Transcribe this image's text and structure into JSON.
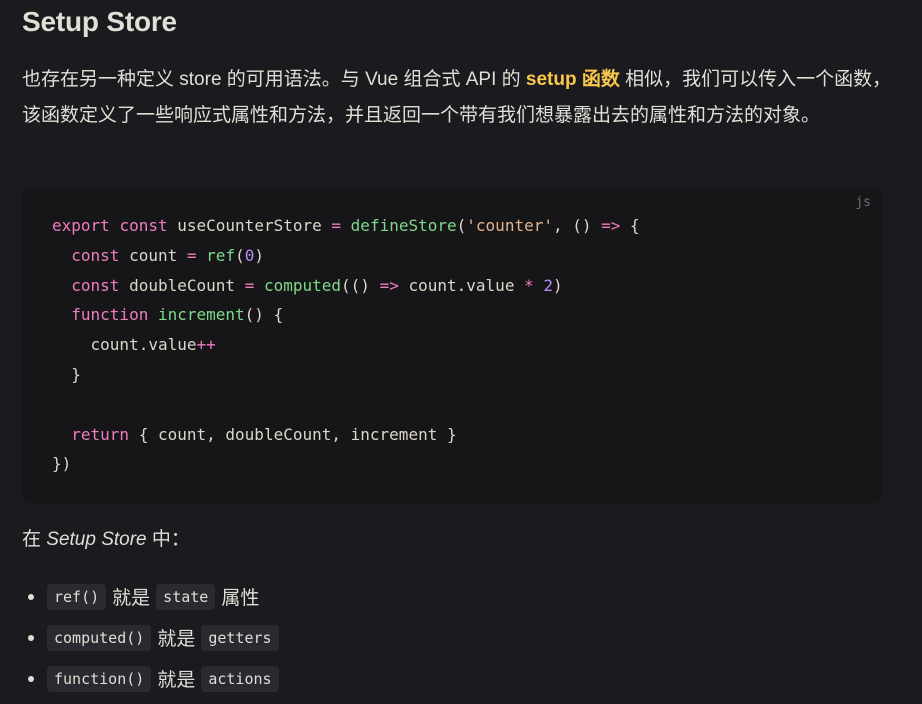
{
  "heading": "Setup Store",
  "intro": {
    "part1": "也存在另一种定义 store 的可用语法。与 Vue 组合式 API 的 ",
    "link": "setup 函数",
    "part2": " 相似，我们可以传入一个函数，该函数定义了一些响应式属性和方法，并且返回一个带有我们想暴露出去的属性和方法的对象。"
  },
  "code": {
    "lang": "js",
    "lines": [
      "export const useCounterStore = defineStore('counter', () => {",
      "  const count = ref(0)",
      "  const doubleCount = computed(() => count.value * 2)",
      "  function increment() {",
      "    count.value++",
      "  }",
      "",
      "  return { count, doubleCount, increment }",
      "})"
    ]
  },
  "subheading": {
    "prefix": "在 ",
    "em": "Setup Store",
    "suffix": " 中："
  },
  "list": [
    {
      "code": "ref()",
      "word": "就是",
      "target": "state",
      "suffix": "属性"
    },
    {
      "code": "computed()",
      "word": "就是",
      "target": "getters",
      "suffix": ""
    },
    {
      "code": "function()",
      "word": "就是",
      "target": "actions",
      "suffix": ""
    }
  ],
  "colors": {
    "background": "#1b1b1f",
    "code_background": "#161618",
    "link": "#f9c84a",
    "keyword": "#f07cc0",
    "function": "#7fd98a",
    "string": "#e5b48b",
    "number": "#b68cf2"
  }
}
